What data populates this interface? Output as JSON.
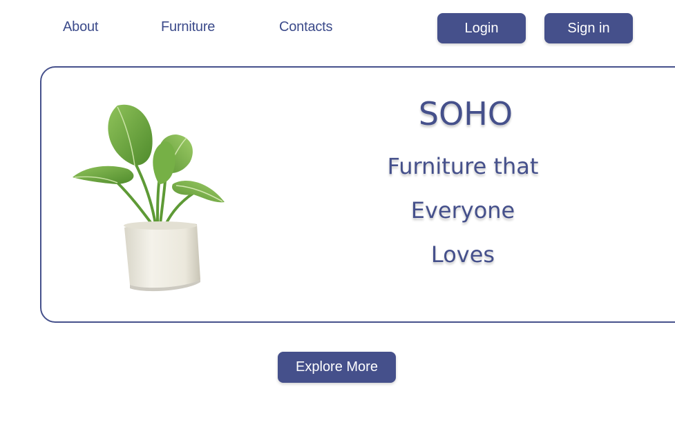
{
  "nav": {
    "links": [
      "About",
      "Furniture",
      "Contacts"
    ],
    "login_label": "Login",
    "signin_label": "Sign in"
  },
  "hero": {
    "title": "SOHO",
    "lines": [
      "Furniture that",
      "Everyone",
      "Loves"
    ],
    "image_icon": "potted-plant"
  },
  "cta": {
    "explore_label": "Explore More"
  },
  "colors": {
    "accent": "#45508b",
    "link": "#3b4a8a",
    "background": "#ffffff"
  }
}
